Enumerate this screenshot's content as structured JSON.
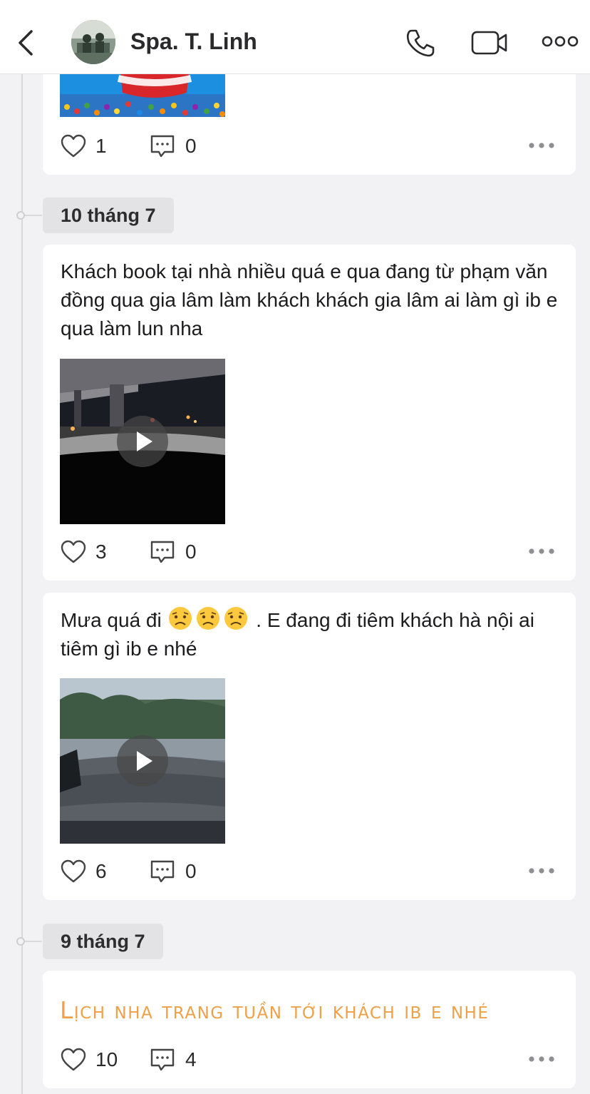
{
  "header": {
    "back_icon": "chevron-left-icon",
    "title": "Spa. T. Linh",
    "call_icon": "phone-icon",
    "video_icon": "video-camera-icon",
    "more_icon": "more-horizontal-icon"
  },
  "posts": [
    {
      "id": "post-0",
      "text": "",
      "has_image": true,
      "likes": "1",
      "comments": "0"
    },
    {
      "id": "post-1",
      "date": "10 tháng 7",
      "text": "Khách book tại nhà nhiều quá e qua đang từ phạm văn đồng qua gia lâm làm khách khách  gia lâm ai làm gì ib e qua làm lun nha",
      "has_video": true,
      "likes": "3",
      "comments": "0"
    },
    {
      "id": "post-2",
      "text_before_emoji": "Mưa quá đi ",
      "emoji_name": "sad-face-emoji",
      "text_after_emoji": " . E  đang đi tiêm khách hà nội ai tiêm gì ib e nhé",
      "has_video": true,
      "likes": "6",
      "comments": "0"
    },
    {
      "id": "post-3",
      "date": "9 tháng 7",
      "text": "Lịch nha trang tuần tới khách ib e nhé",
      "likes": "10",
      "comments": "4"
    }
  ],
  "colors": {
    "background": "#f2f2f4",
    "card": "#ffffff",
    "styled_text": "#f0a046",
    "date_chip": "#e3e3e6"
  }
}
